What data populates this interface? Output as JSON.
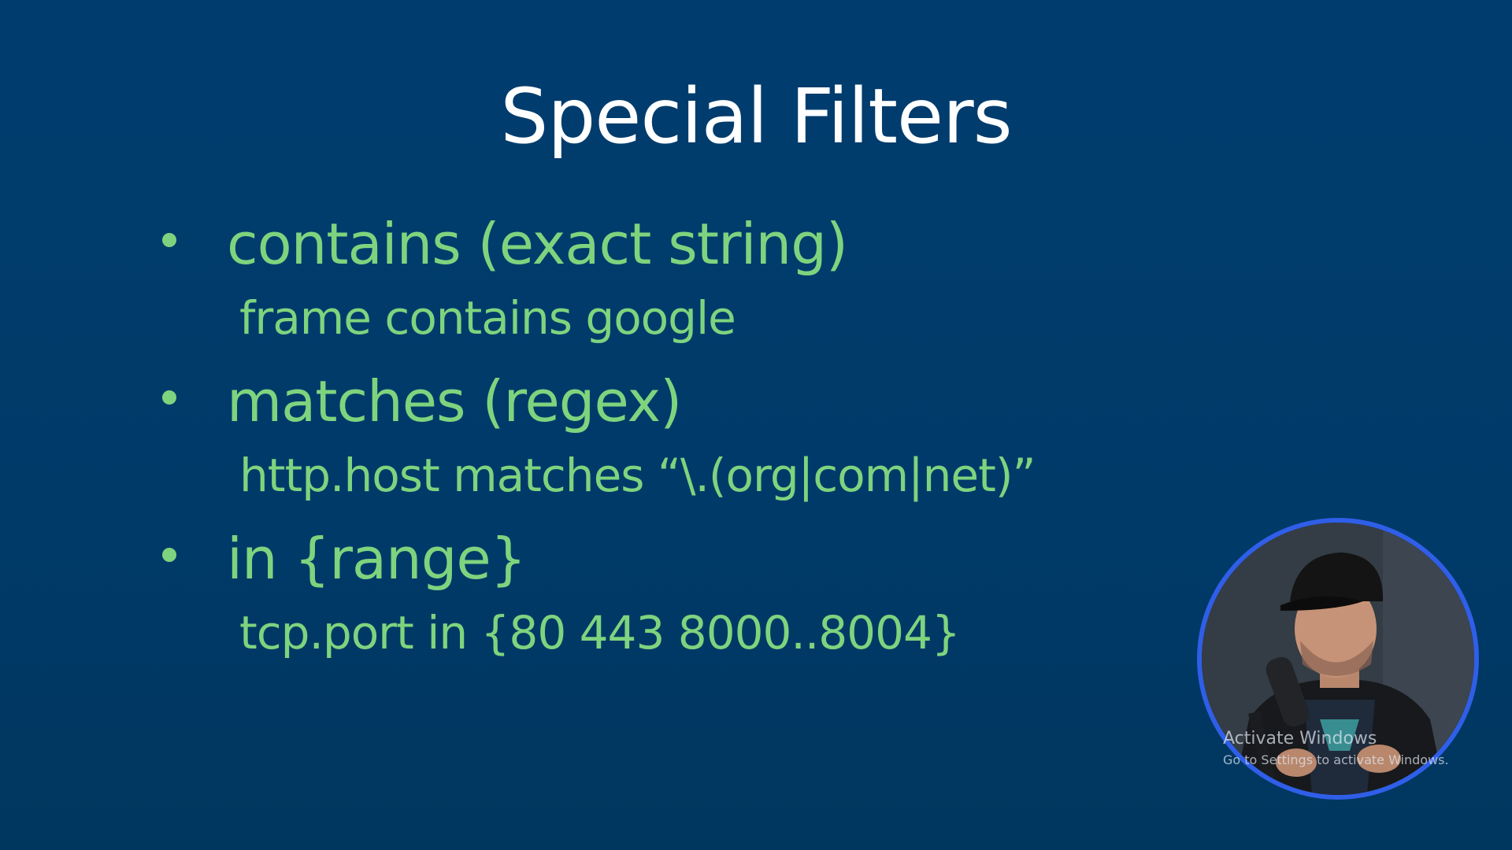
{
  "slide": {
    "title": "Special Filters",
    "items": [
      {
        "head": "contains (exact string)",
        "example": "frame contains google"
      },
      {
        "head": "matches (regex)",
        "example": "http.host matches “\\.(org|com|net)”"
      },
      {
        "head": "in {range}",
        "example": "tcp.port in {80 443 8000..8004}"
      }
    ]
  },
  "watermark": {
    "title": "Activate Windows",
    "subtitle": "Go to Settings to activate Windows."
  },
  "colors": {
    "background": "#003b6b",
    "title_text": "#ffffff",
    "bullet_text": "#7ed47e",
    "presenter_ring": "#2f5fe8"
  }
}
